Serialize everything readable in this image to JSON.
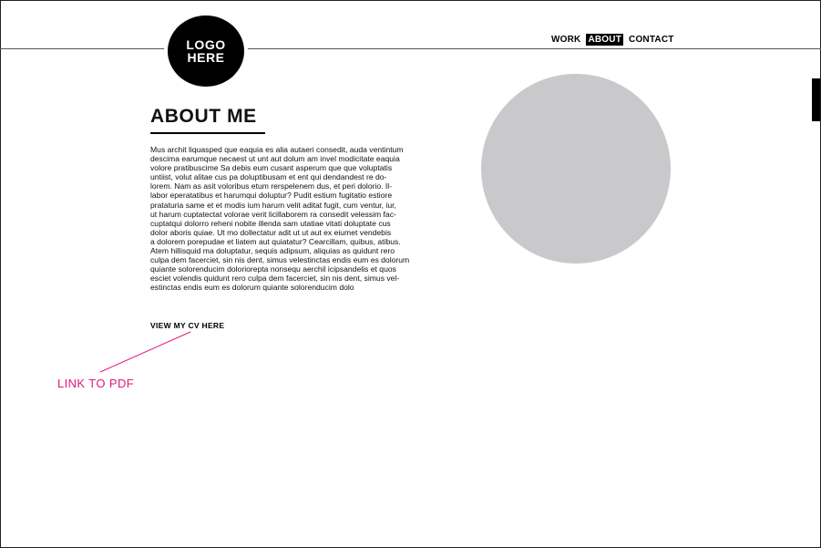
{
  "logo": {
    "line1": "LOGO",
    "line2": "HERE"
  },
  "nav": {
    "items": [
      {
        "label": "WORK",
        "active": false
      },
      {
        "label": "ABOUT",
        "active": true
      },
      {
        "label": "CONTACT",
        "active": false
      }
    ]
  },
  "main": {
    "title": "ABOUT ME",
    "body": "Mus archit liquasped que eaquia es alia autaeri consedit, auda ventintum\ndescima earumque necaest ut unt aut dolum am invel modicitate eaquia\nvolore pratibuscime Sa debis eum cusant asperum que que voluptatis\nuntiist, volut alitae cus pa doluptibusam et ent qui dendandest re do-\nlorem. Nam as asit voloribus etum rerspelenem dus, et peri dolorio. Il-\nlabor eperatatibus et harumqui doluptur? Pudit estium fugitatio estiore\nprataturia same et et modis ium harum velit aditat fugit, cum ventur, iur,\nut harum cuptatectat volorae verit licillaborem ra consedit velessim fac-\ncuptatqui dolorro reheni nobite illenda sam utatiae vitati doluptate cus\ndolor aboris quiae. Ut mo dollectatur adit ut ut aut ex eiumet vendebis\na dolorem porepudae et liatem aut quiatatur? Cearcillam, quibus, atibus.\nAtem hillisquid ma doluptatur, sequis adipsum, aliquias as quidunt rero\nculpa dem facerciet, sin nis dent, simus velestinctas endis eum es dolorum\nquiante solorenducim doloriorepta nonsequ aerchil icipsandelis et quos\nesciet volendis quidunt rero culpa dem facerciet, sin nis dent, simus vel-\nestinctas endis eum es dolorum quiante solorenducim dolo",
    "cv_link": "VIEW MY CV HERE"
  },
  "annotation": {
    "label": "LINK TO PDF",
    "color": "#e0197d"
  },
  "colors": {
    "photo_placeholder": "#c9c9cb",
    "text": "#111111",
    "nav_active_bg": "#000000"
  }
}
